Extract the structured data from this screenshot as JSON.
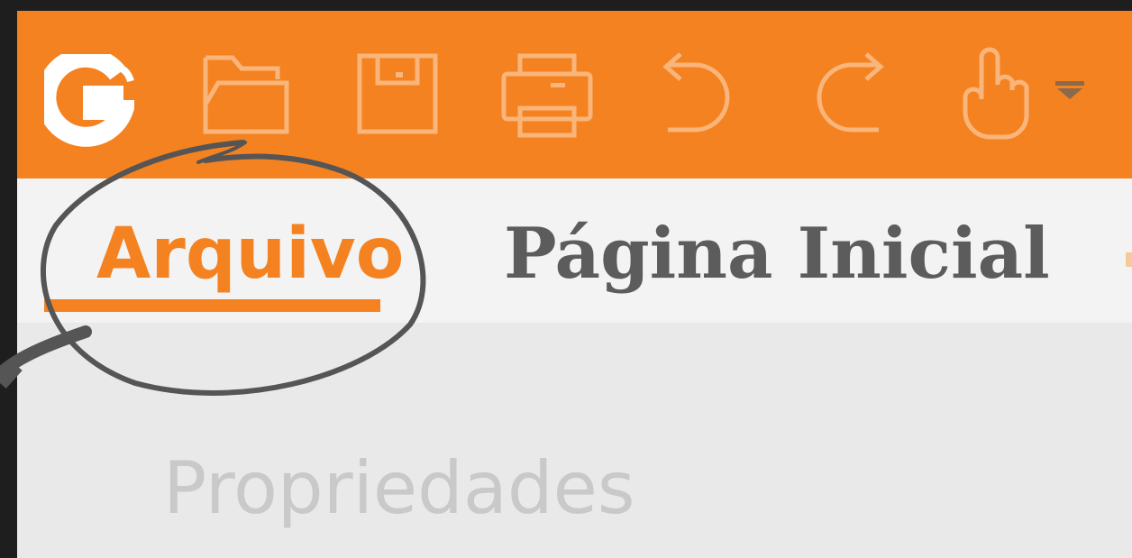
{
  "toolbar": {
    "background": "#f48221",
    "icons": [
      "app-logo-icon",
      "open-folder-icon",
      "save-icon",
      "print-icon",
      "undo-icon",
      "redo-icon",
      "hand-tool-icon",
      "dropdown-arrow-icon"
    ]
  },
  "tabs": {
    "file_label": "Arquivo",
    "home_label": "Página Inicial",
    "active": "Arquivo"
  },
  "file_menu": {
    "items": [
      "Propriedades"
    ]
  },
  "annotation": {
    "type": "hand-drawn circle with arrow",
    "color": "#555555",
    "target": "Arquivo"
  }
}
